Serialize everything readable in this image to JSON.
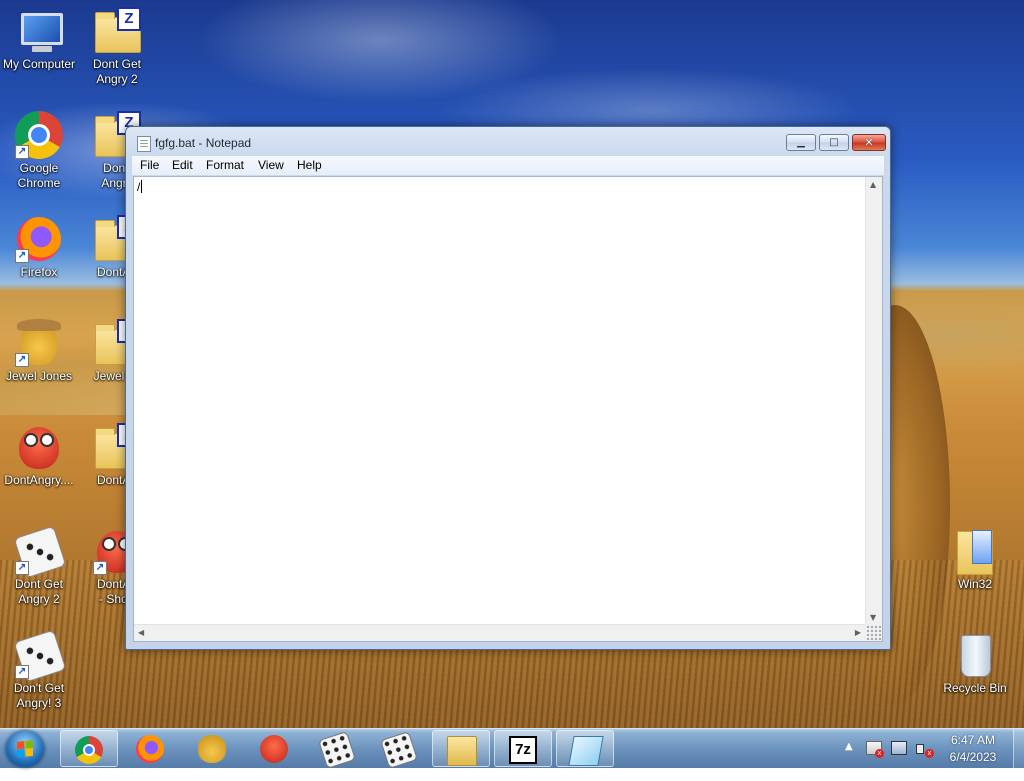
{
  "desktop": {
    "icons": [
      {
        "label": "My Computer",
        "icon": "computer-icon"
      },
      {
        "label": "Dont Get\nAngry 2",
        "icon": "zip-folder-icon"
      },
      {
        "label": "Google\nChrome",
        "icon": "chrome-icon"
      },
      {
        "label": "Don't\nAngry",
        "icon": "zip-folder-icon"
      },
      {
        "label": "Firefox",
        "icon": "firefox-icon"
      },
      {
        "label": "DontAn",
        "icon": "zip-folder-icon"
      },
      {
        "label": "Jewel Jones",
        "icon": "jewel-jones-icon"
      },
      {
        "label": "Jewel Jo",
        "icon": "zip-folder-icon"
      },
      {
        "label": "DontAngry....",
        "icon": "dont-angry-icon"
      },
      {
        "label": "DontAn",
        "icon": "zip-folder-icon"
      },
      {
        "label": "Dont Get\nAngry 2",
        "icon": "dice-icon"
      },
      {
        "label": "DontAn\n- Short",
        "icon": "dont-angry-icon"
      },
      {
        "label": "Don't Get\nAngry! 3",
        "icon": "dice-icon"
      },
      {
        "label": "Win32",
        "icon": "folder-icon"
      },
      {
        "label": "Recycle Bin",
        "icon": "recycle-bin-icon"
      }
    ]
  },
  "notepad": {
    "title": "fgfg.bat - Notepad",
    "menu": [
      "File",
      "Edit",
      "Format",
      "View",
      "Help"
    ],
    "content": "/",
    "controls": {
      "minimize": "▁",
      "maximize": "□",
      "close": "✕"
    }
  },
  "taskbar": {
    "start_label": "Start",
    "pinned": [
      "chrome-icon",
      "firefox-icon",
      "jewel-jones-icon",
      "dont-angry-icon",
      "dice-icon",
      "dice-icon",
      "file-explorer-icon",
      "7zip-icon",
      "notepad-icon"
    ],
    "sevenzip_text": "7z",
    "clock": {
      "time": "6:47 AM",
      "date": "6/4/2023"
    },
    "tray_arrow": "▲"
  }
}
